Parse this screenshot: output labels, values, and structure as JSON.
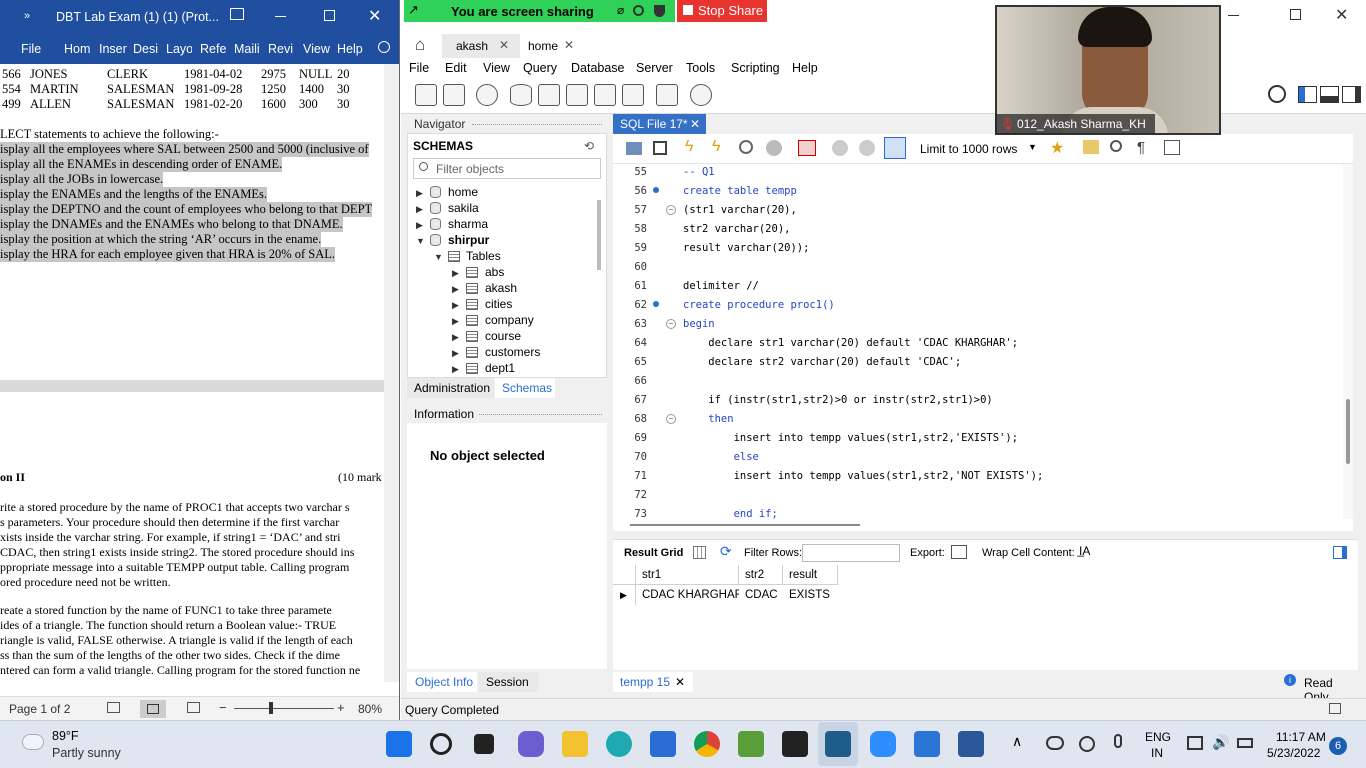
{
  "share": {
    "status": "You are screen sharing",
    "stop_label": "Stop Share"
  },
  "video": {
    "participant": "012_Akash Sharma_KH"
  },
  "word": {
    "title": "DBT Lab Exam (1) (1) (Prot...",
    "ribbon_tabs": [
      "File",
      "Hom",
      "Inser",
      "Desi",
      "Layo",
      "Refe",
      "Maili",
      "Revi",
      "View",
      "Help"
    ],
    "table_rows": [
      [
        "566",
        "JONES",
        "CLERK",
        "1981-04-02",
        "2975",
        "NULL",
        "20"
      ],
      [
        "554",
        "MARTIN",
        "SALESMAN",
        "1981-09-28",
        "1250",
        "1400",
        "30"
      ],
      [
        "499",
        "ALLEN",
        "SALESMAN",
        "1981-02-20",
        "1600",
        "300",
        "30"
      ]
    ],
    "intro": "LECT statements to achieve the following:-",
    "tasks": [
      "isplay all the employees where SAL between 2500 and 5000 (inclusive of",
      "isplay all the ENAMEs in descending order of ENAME.",
      "isplay all the JOBs in lowercase.",
      "isplay the ENAMEs and the lengths of the ENAMEs.",
      "isplay the DEPTNO and the count of employees who belong to that DEPT",
      "isplay the DNAMEs and the ENAMEs who belong to that DNAME.",
      "isplay the position at which the string ‘AR’ occurs in the ename.",
      "isplay the HRA for each employee given that HRA is 20% of SAL."
    ],
    "section_title": "on II",
    "section_marks": "(10 mark",
    "para1": [
      "rite a stored procedure by the name of PROC1 that accepts two varchar s",
      "s parameters. Your procedure should then determine if the first varchar",
      "xists inside the varchar string. For example, if string1 = ‘DAC’ and stri",
      "CDAC, then string1 exists inside string2.  The stored procedure should ins",
      "ppropriate message into a suitable TEMPP output table. Calling program",
      "ored procedure need not be written."
    ],
    "para2": [
      "reate a stored function by the name of FUNC1 to take three paramete",
      "ides of a triangle. The function should return a Boolean value:- TRUE",
      "riangle is valid, FALSE otherwise. A triangle is valid if the length of each",
      "ss than the sum of the lengths of the other two sides. Check if the dime",
      "ntered can form a valid triangle. Calling program for the stored function ne"
    ],
    "status": {
      "page": "Page 1 of 2",
      "zoom": "80%"
    }
  },
  "workbench": {
    "tabs": [
      "akash",
      "home"
    ],
    "menu": [
      "File",
      "Edit",
      "View",
      "Query",
      "Database",
      "Server",
      "Tools",
      "Scripting",
      "Help"
    ],
    "navigator": {
      "header": "Navigator",
      "schemas_label": "SCHEMAS",
      "filter_placeholder": "Filter objects",
      "schemas": [
        "home",
        "sakila",
        "sharma",
        "shirpur"
      ],
      "tables_label": "Tables",
      "tables": [
        "abs",
        "akash",
        "cities",
        "company",
        "course",
        "customers",
        "dept1"
      ],
      "tabs": [
        "Administration",
        "Schemas"
      ]
    },
    "information": {
      "header": "Information",
      "empty": "No object selected",
      "tabs": [
        "Object Info",
        "Session"
      ]
    },
    "editor": {
      "tab_label": "SQL File 17*",
      "limit": "Limit to 1000 rows",
      "line_numbers": [
        "55",
        "56",
        "57",
        "58",
        "59",
        "60",
        "61",
        "62",
        "63",
        "64",
        "65",
        "66",
        "67",
        "68",
        "69",
        "70",
        "71",
        "72",
        "73"
      ],
      "lines": [
        "-- Q1",
        "create table tempp",
        "(str1 varchar(20),",
        "str2 varchar(20),",
        "result varchar(20));",
        "",
        "delimiter //",
        "create procedure proc1()",
        "begin",
        "    declare str1 varchar(20) default 'CDAC KHARGHAR';",
        "    declare str2 varchar(20) default 'CDAC';",
        "",
        "    if (instr(str1,str2)>0 or instr(str2,str1)>0)",
        "    then",
        "        insert into tempp values(str1,str2,'EXISTS');",
        "        else",
        "        insert into tempp values(str1,str2,'NOT EXISTS');",
        "",
        "        end if;"
      ]
    },
    "results": {
      "grid_label": "Result Grid",
      "filter_label": "Filter Rows:",
      "export_label": "Export:",
      "wrap_label": "Wrap Cell Content:",
      "columns": [
        "str1",
        "str2",
        "result"
      ],
      "rows": [
        [
          "CDAC KHARGHAR",
          "CDAC",
          "EXISTS"
        ]
      ],
      "tab_label": "tempp 15",
      "read_only": "Read Only"
    },
    "status": "Query Completed"
  },
  "taskbar": {
    "weather": {
      "temp": "89°F",
      "desc": "Partly sunny"
    },
    "lang": {
      "top": "ENG",
      "bottom": "IN"
    },
    "time": "11:17 AM",
    "date": "5/23/2022",
    "badge": "6"
  }
}
